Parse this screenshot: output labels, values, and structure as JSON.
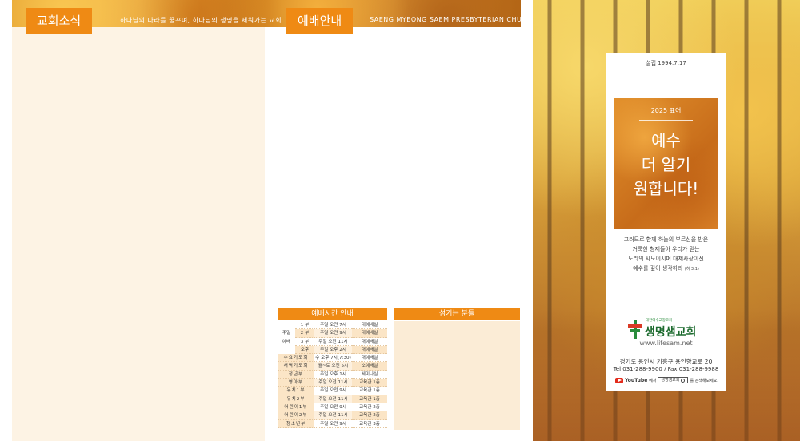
{
  "banner": {
    "news_tag": "교회소식",
    "news_subtitle": "하나님의 나라를 꿈꾸며, 하나님의 생명을 세워가는 교회",
    "worship_tag": "예배안내",
    "worship_subtitle": "SAENG MYEONG SAEM PRESBYTERIAN CHURCH"
  },
  "schedule": {
    "title": "예배시간 안내",
    "group_label": [
      "주일",
      "예배"
    ],
    "rows": [
      {
        "name": "1 부",
        "time": "주일 오전 7시",
        "place": "대예배실"
      },
      {
        "name": "2 부",
        "time": "주일 오전 9시",
        "place": "대예배실"
      },
      {
        "name": "3 부",
        "time": "주일 오전 11시",
        "place": "대예배실"
      },
      {
        "name": "오후",
        "time": "주일 오후 2시",
        "place": "대예배실"
      }
    ],
    "wide_rows": [
      {
        "name": "수요기도회",
        "time": "수 오후 7시(7:30)",
        "place": "대예배실"
      },
      {
        "name": "새벽기도회",
        "time": "월~토 오전 5시",
        "place": "소예배실"
      },
      {
        "name": "청년부",
        "time": "주일 오후 1시",
        "place": "세미나실"
      },
      {
        "name": "영아부",
        "time": "주일 오전 11시",
        "place": "교육관 1층"
      },
      {
        "name": "유치1부",
        "time": "주일 오전 9시",
        "place": "교육관 1층"
      },
      {
        "name": "유치2부",
        "time": "주일 오전 11시",
        "place": "교육관 1층"
      },
      {
        "name": "어린이1부",
        "time": "주일 오전 9시",
        "place": "교육관 2층"
      },
      {
        "name": "어린이2부",
        "time": "주일 오전 11시",
        "place": "교육관 2층"
      },
      {
        "name": "청소년부",
        "time": "주일 오전 9시",
        "place": "교육관 3층"
      }
    ]
  },
  "choir": {
    "title": "섬기는 분들"
  },
  "cover": {
    "founded": "설립 1994.7.17",
    "motto_year": "2025 표어",
    "motto_lines": [
      "예수",
      "더 알기",
      "원합니다!"
    ],
    "verse_lines": [
      "그러므로 함께 하늘의 부르심을 받은",
      "거룩한 형제들아 우리가 믿는",
      "도리의 사도이시며 대제사장이신",
      "예수를 깊이 생각하라"
    ],
    "verse_ref": "(히 3:1)",
    "denomination": "대한예수교장로회",
    "church_name": "생명샘교회",
    "website": "www.lifesam.net",
    "address": "경기도 용인시 기흥구 용인향교로 20",
    "tel": "Tel 031-288-9900 / Fax 031-288-9988",
    "youtube_word": "YouTube",
    "youtube_suffix": "에서",
    "youtube_search": "생명샘교회",
    "youtube_after": "를 검색해보세요."
  },
  "colors": {
    "accent": "#ef8a14",
    "cream": "#fdf3e4",
    "logo_green": "#2a8c3c",
    "logo_red": "#d93a25"
  }
}
